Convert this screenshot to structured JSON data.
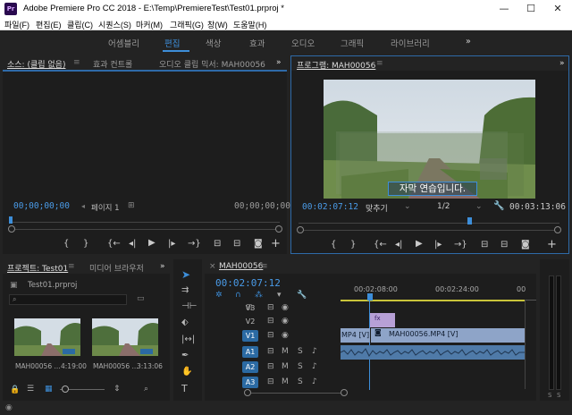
{
  "window": {
    "app_icon": "Pr",
    "title": "Adobe Premiere Pro CC 2018 - E:\\Temp\\PremiereTest\\Test01.prproj *",
    "minimize": "—",
    "maximize": "☐",
    "close": "✕"
  },
  "menu": [
    "파일(F)",
    "편집(E)",
    "클립(C)",
    "시퀀스(S)",
    "마커(M)",
    "그래픽(G)",
    "창(W)",
    "도움말(H)"
  ],
  "workspaces": [
    "어셈블리",
    "편집",
    "색상",
    "효과",
    "오디오",
    "그래픽",
    "라이브러리"
  ],
  "workspace_active": "편집",
  "workspace_more": "»",
  "source_panel": {
    "tabs": [
      "소스: (클립 없음)",
      "효과 컨트롤",
      "오디오 클립 믹서: MAH00056"
    ],
    "timecode_in": "00;00;00;00",
    "page_label": "페이지 1",
    "timecode_out": "00;00;00;00"
  },
  "program_panel": {
    "tab": "프로그램: MAH00056",
    "subtitle": "자막 연습입니다.",
    "timecode": "00:02:07:12",
    "fit": "맞추기",
    "resolution": "1/2",
    "duration": "00:03:13:06"
  },
  "project_panel": {
    "tabs": [
      "프로젝트: Test01",
      "미디어 브라우저"
    ],
    "file": "Test01.prproj",
    "items": [
      {
        "name": "MAH00056 ...",
        "duration": "4:19:00"
      },
      {
        "name": "MAH00056 ...",
        "duration": "3:13:06"
      }
    ]
  },
  "timeline": {
    "tab": "MAH00056",
    "timecode": "00:02:07:12",
    "ruler": [
      "00:02:08:00",
      "00:02:24:00",
      "00"
    ],
    "tracks": {
      "video": [
        "V3",
        "V2",
        "V1"
      ],
      "audio": [
        "A1",
        "A2",
        "A3"
      ]
    },
    "mute": "M",
    "solo": "S",
    "clip_left": "MP4 [V]",
    "clip_right": "MAH00056.MP4 [V]",
    "graphic_clip": "fx"
  },
  "colors": {
    "accent": "#3d8ed9",
    "panel": "#1d1d1d",
    "clip_video": "#8ea4c8",
    "clip_audio": "#4f7aa8",
    "graphic_clip": "#b7a0d6"
  }
}
